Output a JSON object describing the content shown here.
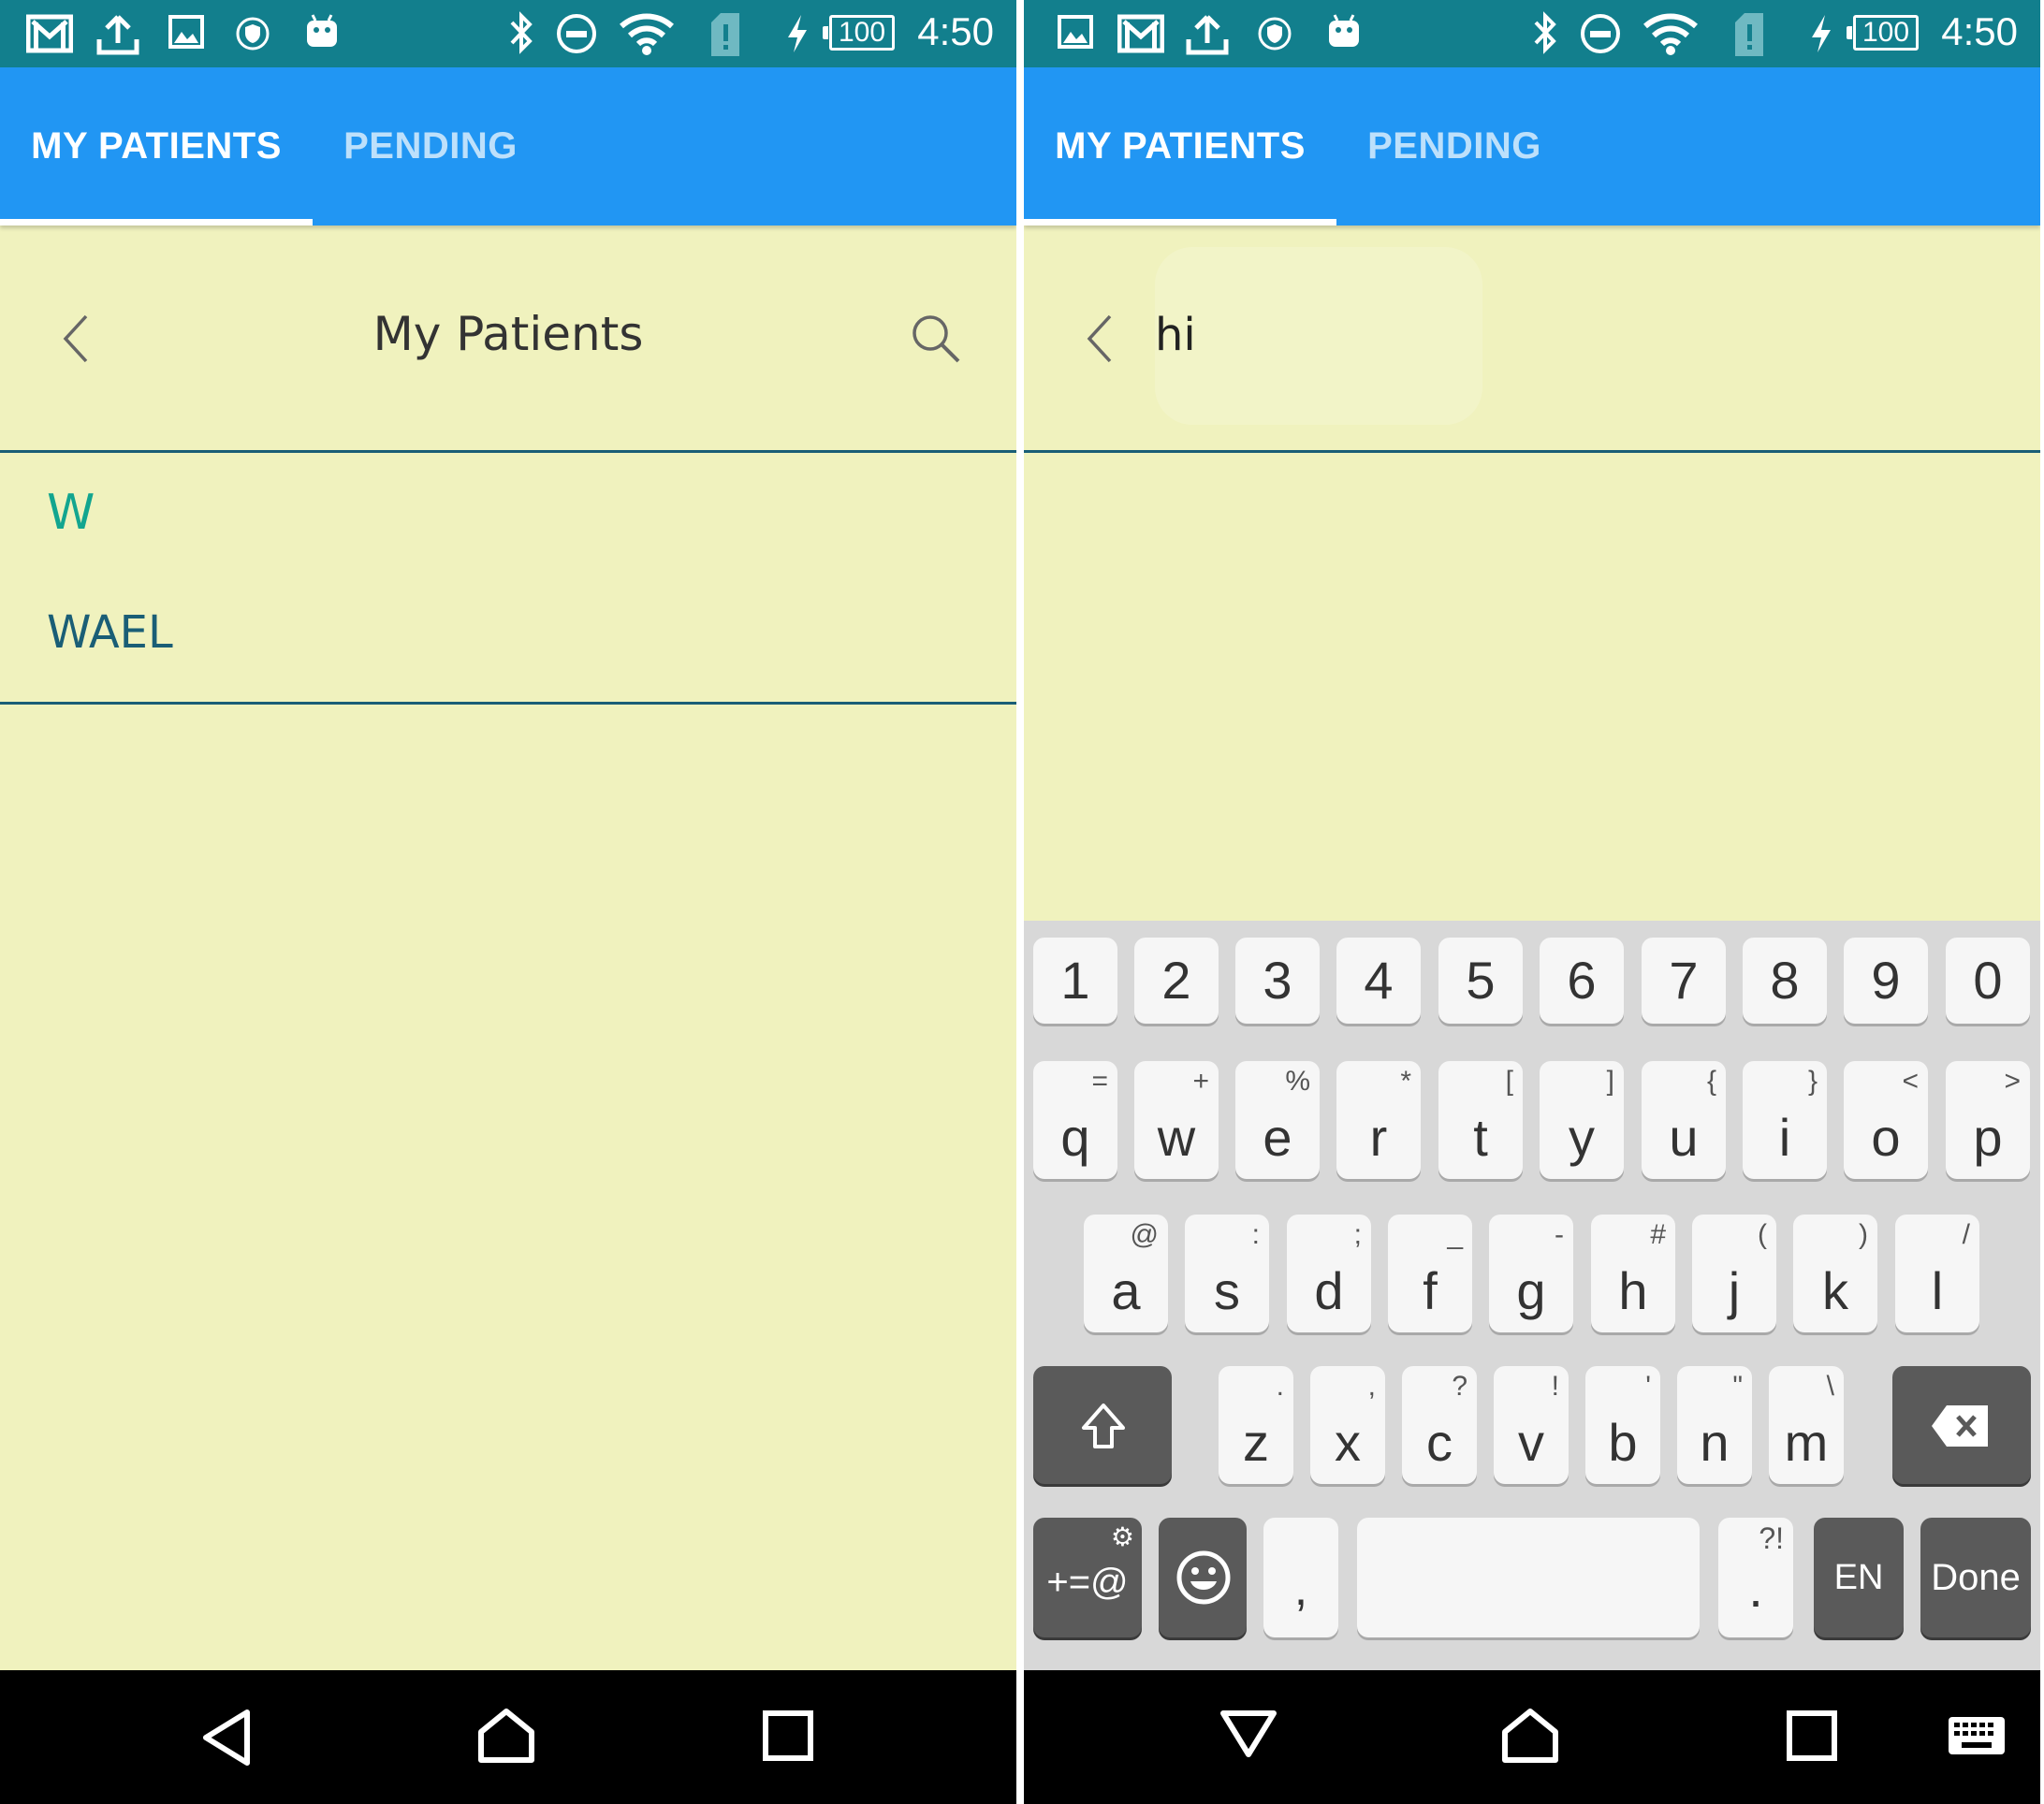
{
  "status_bar": {
    "time": "4:50",
    "battery": "100",
    "icons": [
      "gmail-icon",
      "upload-icon",
      "image-icon",
      "vpn-shield-icon",
      "android-icon",
      "bluetooth-icon",
      "do-not-disturb-icon",
      "wifi-icon",
      "sim-alert-icon",
      "charging-icon"
    ]
  },
  "tabs": [
    {
      "label": "MY PATIENTS",
      "active": true
    },
    {
      "label": "PENDING",
      "active": false
    }
  ],
  "left_screen": {
    "title": "My Patients",
    "section_letter": "W",
    "patients": [
      "WAEL"
    ]
  },
  "right_screen": {
    "search_query": "hi"
  },
  "keyboard": {
    "number_row": [
      "1",
      "2",
      "3",
      "4",
      "5",
      "6",
      "7",
      "8",
      "9",
      "0"
    ],
    "row1": [
      {
        "key": "q",
        "hint": "="
      },
      {
        "key": "w",
        "hint": "+"
      },
      {
        "key": "e",
        "hint": "%"
      },
      {
        "key": "r",
        "hint": "*"
      },
      {
        "key": "t",
        "hint": "["
      },
      {
        "key": "y",
        "hint": "]"
      },
      {
        "key": "u",
        "hint": "{"
      },
      {
        "key": "i",
        "hint": "}"
      },
      {
        "key": "o",
        "hint": "<"
      },
      {
        "key": "p",
        "hint": ">"
      }
    ],
    "row2": [
      {
        "key": "a",
        "hint": "@"
      },
      {
        "key": "s",
        "hint": ":"
      },
      {
        "key": "d",
        "hint": ";"
      },
      {
        "key": "f",
        "hint": "_"
      },
      {
        "key": "g",
        "hint": "-"
      },
      {
        "key": "h",
        "hint": "#"
      },
      {
        "key": "j",
        "hint": "("
      },
      {
        "key": "k",
        "hint": ")"
      },
      {
        "key": "l",
        "hint": "/"
      }
    ],
    "row3": [
      {
        "key": "z",
        "hint": "."
      },
      {
        "key": "x",
        "hint": ","
      },
      {
        "key": "c",
        "hint": "?"
      },
      {
        "key": "v",
        "hint": "!"
      },
      {
        "key": "b",
        "hint": "'"
      },
      {
        "key": "n",
        "hint": "\""
      },
      {
        "key": "m",
        "hint": "\\"
      }
    ],
    "symbols_label": "+=@",
    "comma_label": ",",
    "period_label": ".",
    "period_hint": "?!",
    "language_label": "EN",
    "done_label": "Done"
  },
  "colors": {
    "status_bar": "#127F8D",
    "tab_bar": "#2196F3",
    "content_background": "#F0F2BE",
    "divider": "#1A5E76",
    "section_letter": "#12A58F",
    "patient_name": "#1A5E76"
  }
}
